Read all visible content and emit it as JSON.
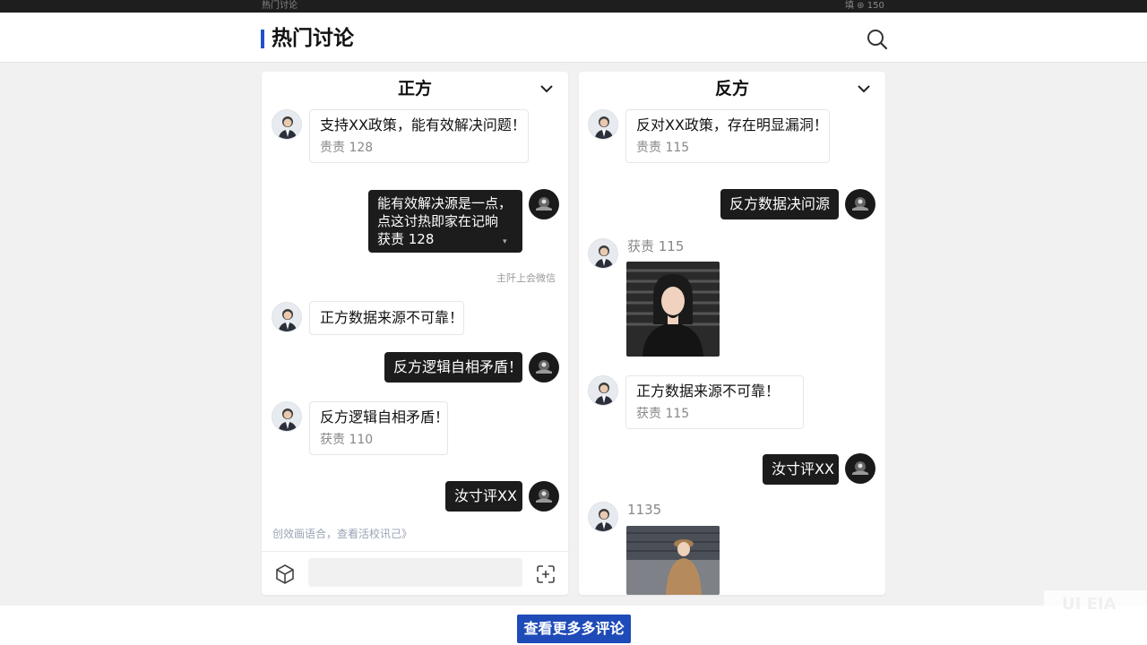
{
  "statusbar": {
    "left_text": "热门讨论",
    "right_text": "填 ⊛ 150"
  },
  "header": {
    "title": "热门讨论"
  },
  "colors": {
    "accent": "#2151c9",
    "button": "#1e4bb8",
    "dark_bubble": "#1c1c1c"
  },
  "left_panel": {
    "title": "正方",
    "messages": [
      {
        "side": "left",
        "text": "支持XX政策，能有效解决问题！",
        "meta": "贵责 128"
      },
      {
        "side": "right",
        "lines": [
          "能有效解决源是一点，",
          "点这讨热即家在记晌"
        ],
        "meta": "获责 128"
      },
      {
        "side": "left",
        "text": "正方数据来源不可靠！"
      },
      {
        "side": "right",
        "text": "反方逻辑自相矛盾！"
      },
      {
        "side": "left",
        "text": "反方逻辑自相矛盾！",
        "meta": "获责 110"
      },
      {
        "side": "right",
        "text": "汝寸评XX"
      }
    ],
    "note": "主阡上会微信",
    "footer_hint": "创效画语合，查看活校讯己》",
    "input_placeholder": ""
  },
  "right_panel": {
    "title": "反方",
    "messages": [
      {
        "side": "left",
        "text": "反对XX政策，存在明显漏洞！",
        "meta": "贵责 115"
      },
      {
        "side": "right",
        "text": "反方数据决问源"
      },
      {
        "side": "left",
        "name": "获责 115",
        "image": "woman-portrait"
      },
      {
        "side": "left",
        "text": "正方数据来源不可靠！",
        "meta": "获责 115"
      },
      {
        "side": "right",
        "text": "汝寸评XX"
      },
      {
        "side": "left",
        "name": "1135",
        "image": "woman-street"
      }
    ]
  },
  "more_button": "查看更多多评论",
  "watermark": "UI EIA"
}
